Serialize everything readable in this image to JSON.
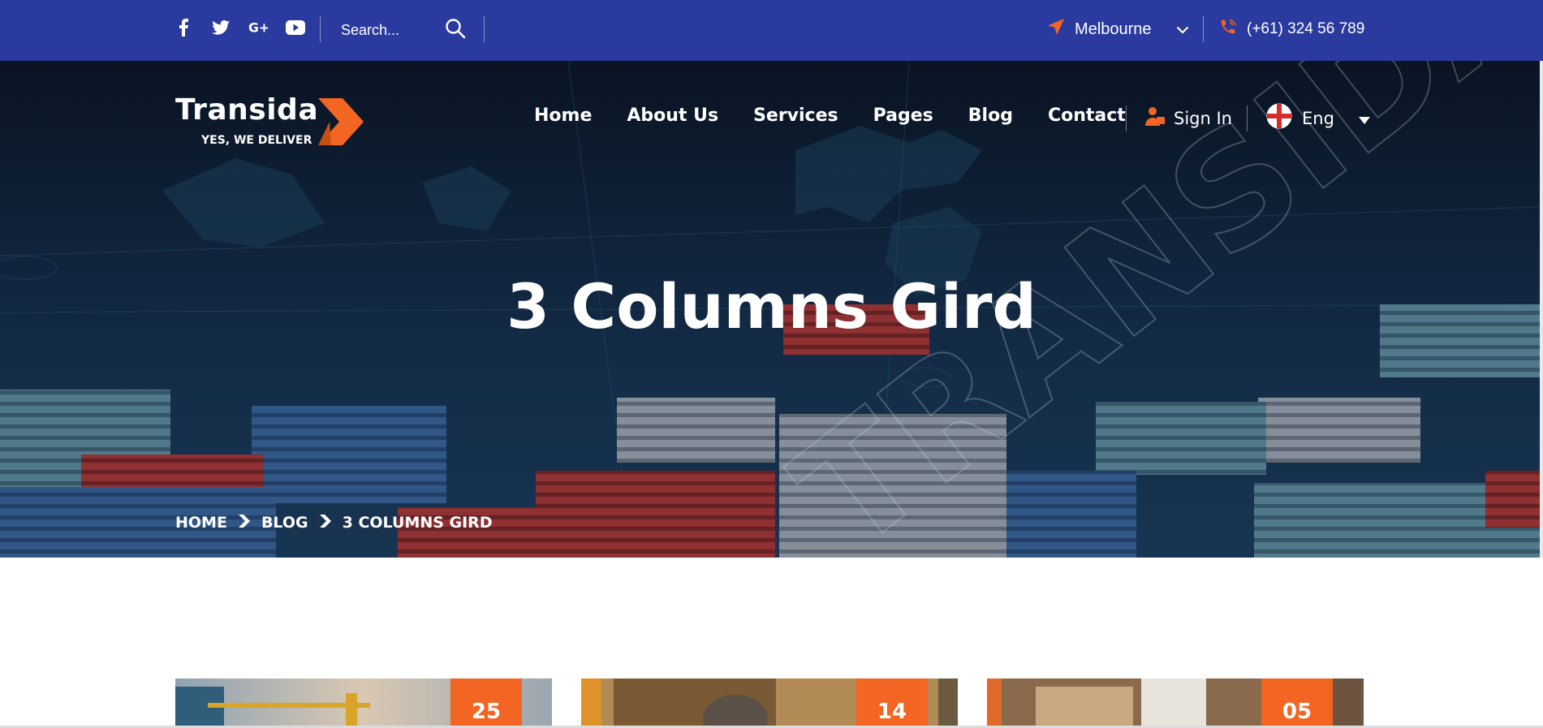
{
  "topbar": {
    "social": [
      "facebook-icon",
      "twitter-icon",
      "google-plus-icon",
      "youtube-icon"
    ],
    "search_placeholder": "Search...",
    "location": "Melbourne",
    "phone": "(+61) 324 56 789"
  },
  "brand": {
    "name": "Transida",
    "tagline": "YES, WE DELIVER"
  },
  "nav": {
    "items": [
      "Home",
      "About Us",
      "Services",
      "Pages",
      "Blog",
      "Contact"
    ],
    "sign_in": "Sign In",
    "language": "Eng"
  },
  "hero": {
    "title": "3 Columns Gird",
    "watermark": "TRANSIDA",
    "breadcrumb": [
      "HOME",
      "BLOG",
      "3 COLUMNS GIRD"
    ]
  },
  "posts": [
    {
      "day": "25"
    },
    {
      "day": "14"
    },
    {
      "day": "05"
    }
  ],
  "colors": {
    "topbar": "#2b3a9e",
    "accent": "#f26522",
    "hero_dark": "#0b1322"
  }
}
